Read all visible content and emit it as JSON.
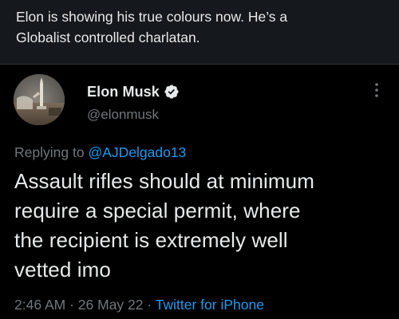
{
  "parent_tweet": {
    "text_line1": "Elon is showing his true colours now. He’s a",
    "text_line2": "Globalist controlled charlatan."
  },
  "tweet": {
    "display_name": "Elon Musk",
    "handle": "@elonmusk",
    "verified": true,
    "replying_prefix": "Replying to",
    "replying_to": "@AJDelgado13",
    "text_lines": [
      "Assault rifles should at minimum",
      "require a special permit, where",
      "the recipient is extremely well",
      "vetted imo"
    ],
    "time": "2:46 AM",
    "separator": "·",
    "date": "26 May 22",
    "source": "Twitter for iPhone"
  },
  "icons": {
    "verified": "verified-badge-icon",
    "more": "more-options-icon"
  },
  "colors": {
    "background": "#000000",
    "parent_background": "#15181c",
    "text_primary": "#e7e9ea",
    "text_secondary": "#71767b",
    "link": "#1d9bf0"
  }
}
